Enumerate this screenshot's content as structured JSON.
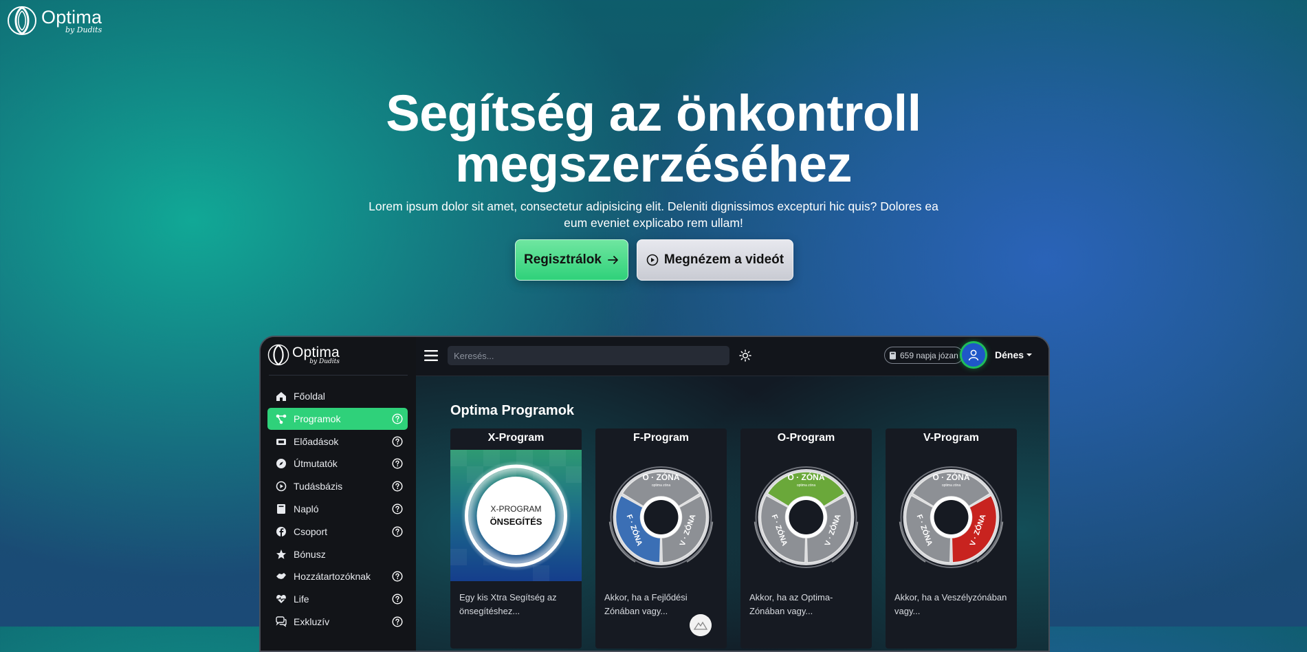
{
  "brand": {
    "name": "Optima",
    "by": "by Dudits"
  },
  "hero": {
    "title_line1": "Segítség az önkontroll",
    "title_line2": "megszerzéséhez",
    "subtitle": "Lorem ipsum dolor sit amet, consectetur adipisicing elit. Deleniti dignissimos excepturi hic quis? Dolores ea eum eveniet explicabo rem ullam!",
    "register_label": "Regisztrálok",
    "video_label": "Megnézem a videót"
  },
  "app": {
    "search": {
      "placeholder": "Keresés...",
      "value": ""
    },
    "sober_badge": "659 napja józan",
    "user_name": "Dénes",
    "sidebar": {
      "items": [
        {
          "label": "Főoldal",
          "icon": "home-icon",
          "help": false,
          "active": false
        },
        {
          "label": "Programok",
          "icon": "share-nodes-icon",
          "help": true,
          "active": true
        },
        {
          "label": "Előadások",
          "icon": "ticket-icon",
          "help": true,
          "active": false
        },
        {
          "label": "Útmutatók",
          "icon": "compass-icon",
          "help": true,
          "active": false
        },
        {
          "label": "Tudásbázis",
          "icon": "play-circle-icon",
          "help": true,
          "active": false
        },
        {
          "label": "Napló",
          "icon": "book-icon",
          "help": true,
          "active": false
        },
        {
          "label": "Csoport",
          "icon": "facebook-icon",
          "help": true,
          "active": false
        },
        {
          "label": "Bónusz",
          "icon": "star-icon",
          "help": false,
          "active": false
        },
        {
          "label": "Hozzátartozóknak",
          "icon": "handshake-icon",
          "help": true,
          "active": false
        },
        {
          "label": "Life",
          "icon": "heart-pulse-icon",
          "help": true,
          "active": false
        },
        {
          "label": "Exkluzív",
          "icon": "comments-icon",
          "help": true,
          "active": false
        }
      ]
    },
    "section_title": "Optima Programok",
    "cards": [
      {
        "title": "X-Program",
        "image_line1": "X-PROGRAM",
        "image_line2": "ÖNSEGÍTÉS",
        "desc": "Egy kis Xtra Segítség az önsegítéshez..."
      },
      {
        "title": "F-Program",
        "desc": "Akkor, ha a Fejlődési Zónában vagy..."
      },
      {
        "title": "O-Program",
        "desc": "Akkor, ha az Optima-Zónában vagy..."
      },
      {
        "title": "V-Program",
        "desc": "Akkor, ha a Veszélyzónában vagy..."
      }
    ],
    "zone_labels": {
      "o": "O · ZÓNA",
      "o_sub": "optima zóna",
      "f": "F · ZÓNA",
      "v": "V · ZÓNA"
    }
  },
  "colors": {
    "accent_green": "#2fd17a",
    "zone_blue": "#3b6fb5",
    "zone_green": "#6aa83a",
    "zone_red": "#c8231f"
  }
}
